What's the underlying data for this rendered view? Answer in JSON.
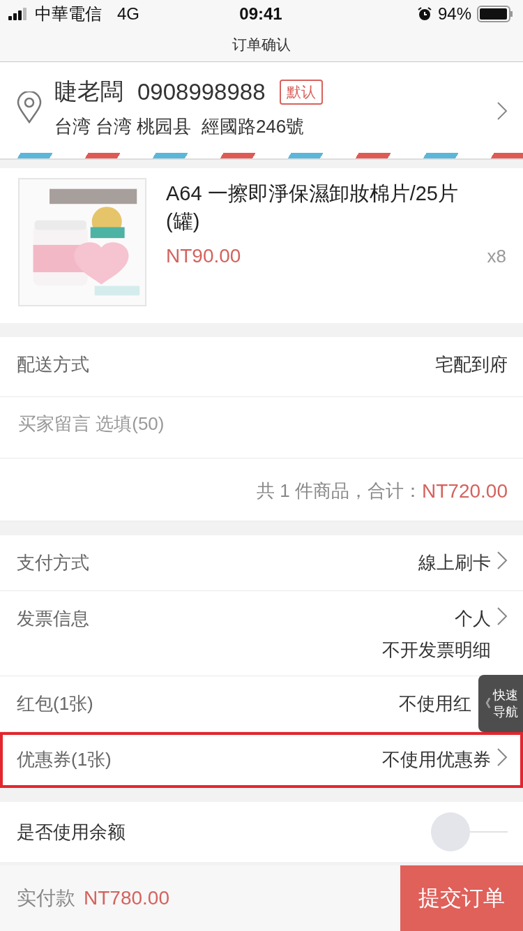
{
  "status_bar": {
    "carrier": "中華電信",
    "network": "4G",
    "time": "09:41",
    "battery": "94%"
  },
  "nav": {
    "title": "订单确认"
  },
  "address": {
    "name": "睫老闆",
    "phone": "0908998988",
    "badge": "默认",
    "line": "台湾 台湾 桃园县  經國路246號"
  },
  "product": {
    "title": "A64 一擦即淨保濕卸妝棉片/25片(罐)",
    "price": "NT90.00",
    "quantity": "x8"
  },
  "order_rows": [
    {
      "kind": "value",
      "label": "配送方式",
      "value": "宅配到府",
      "chevron": false
    },
    {
      "kind": "input",
      "placeholder": "买家留言 选填(50)"
    },
    {
      "kind": "total",
      "text": "共 1 件商品，合计：",
      "amount": "NT720.00"
    }
  ],
  "payment_rows": [
    {
      "label": "支付方式",
      "values": [
        "線上刷卡"
      ],
      "chevron": true,
      "highlighted": false
    },
    {
      "label": "发票信息",
      "values": [
        "个人",
        "不开发票明细"
      ],
      "chevron": true,
      "highlighted": false
    },
    {
      "label": "红包(1张)",
      "values": [
        "不使用红"
      ],
      "chevron": false,
      "highlighted": false
    },
    {
      "label": "优惠券(1张)",
      "values": [
        "不使用优惠券"
      ],
      "chevron": true,
      "highlighted": true
    }
  ],
  "balance": {
    "label": "是否使用余额",
    "on": false
  },
  "quick_nav": {
    "icon": "《",
    "label": "快速导航"
  },
  "footer": {
    "label": "实付款",
    "amount": "NT780.00",
    "submit": "提交订单"
  }
}
